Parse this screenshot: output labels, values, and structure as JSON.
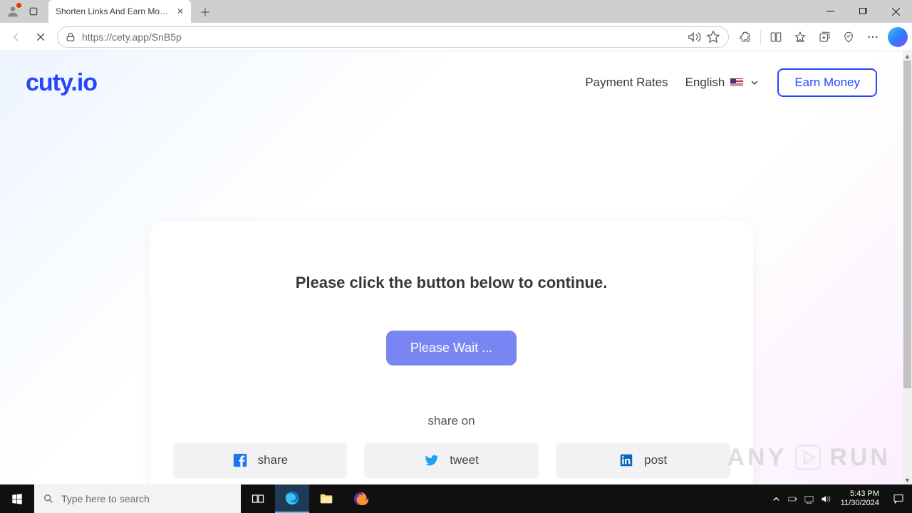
{
  "browser": {
    "tab_title": "Shorten Links And Earn Money |",
    "url": "https://cety.app/SnB5p"
  },
  "header": {
    "logo_text": "cuty.io",
    "nav": {
      "payment_rates": "Payment Rates",
      "language": "English",
      "earn_money": "Earn Money"
    }
  },
  "card": {
    "title": "Please click the button below to continue.",
    "wait_button": "Please Wait ...",
    "share_label": "share on",
    "share": {
      "facebook": "share",
      "twitter": "tweet",
      "linkedin": "post"
    }
  },
  "watermark": {
    "left": "ANY",
    "right": "RUN"
  },
  "taskbar": {
    "search_placeholder": "Type here to search",
    "time": "5:43 PM",
    "date": "11/30/2024"
  }
}
